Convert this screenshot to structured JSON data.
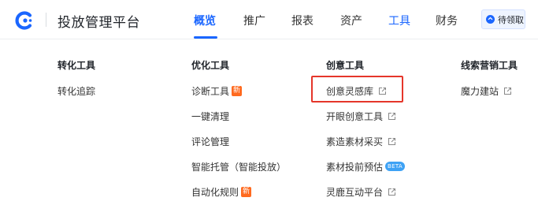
{
  "header": {
    "logo_icon": "brand-logo-icon",
    "app_title": "投放管理平台",
    "nav": [
      {
        "label": "概览",
        "state": "active"
      },
      {
        "label": "推广",
        "state": "normal"
      },
      {
        "label": "报表",
        "state": "normal"
      },
      {
        "label": "资产",
        "state": "normal"
      },
      {
        "label": "工具",
        "state": "highlight"
      },
      {
        "label": "财务",
        "state": "normal"
      }
    ],
    "pending_label": "待领取",
    "accent_color": "#1a66ff"
  },
  "menu": {
    "columns": [
      {
        "title": "转化工具",
        "items": [
          {
            "label": "转化追踪",
            "badge": "",
            "external": false
          }
        ]
      },
      {
        "title": "优化工具",
        "items": [
          {
            "label": "诊断工具",
            "badge": "新",
            "external": false
          },
          {
            "label": "一键清理",
            "badge": "",
            "external": false
          },
          {
            "label": "评论管理",
            "badge": "",
            "external": false
          },
          {
            "label": "智能托管（智能投放）",
            "badge": "",
            "external": false
          },
          {
            "label": "自动化规则",
            "badge": "新",
            "external": false
          }
        ]
      },
      {
        "title": "创意工具",
        "items": [
          {
            "label": "创意灵感库",
            "badge": "",
            "external": true,
            "highlighted": true
          },
          {
            "label": "开眼创意工具",
            "badge": "",
            "external": true
          },
          {
            "label": "素造素材采买",
            "badge": "",
            "external": true
          },
          {
            "label": "素材投前预估",
            "badge": "BETA",
            "external": false
          },
          {
            "label": "灵鹿互动平台",
            "badge": "",
            "external": true
          }
        ]
      },
      {
        "title": "线索营销工具",
        "items": [
          {
            "label": "魔力建站",
            "badge": "",
            "external": true
          }
        ]
      }
    ]
  }
}
